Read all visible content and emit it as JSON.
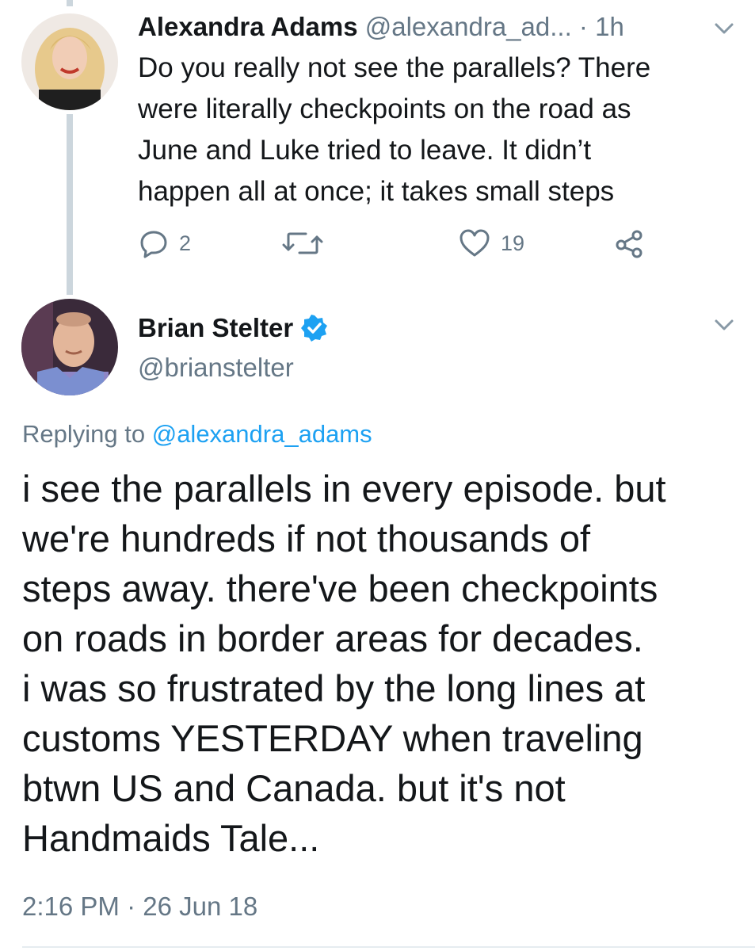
{
  "parent_tweet": {
    "display_name": "Alexandra Adams",
    "handle": "@alexandra_ad...",
    "time": "1h",
    "separator": "·",
    "text": "Do you really not see the parallels? There\nwere literally checkpoints on the road as\nJune and Luke tried to leave. It didn’t\nhappen all at once; it takes small steps",
    "reply_count": "2",
    "retweet_count": "",
    "like_count": "19",
    "icons": [
      "reply-icon",
      "retweet-icon",
      "like-icon",
      "share-icon",
      "chevron-down-icon"
    ]
  },
  "main_tweet": {
    "display_name": "Brian Stelter",
    "handle": "@brianstelter",
    "replying_prefix": "Replying to",
    "replying_handle": "@alexandra_adams",
    "text": "i see the parallels in every episode. but\nwe're hundreds if not thousands of\nsteps away. there've been checkpoints\non roads in border areas for decades.\ni was so frustrated by the long lines at\ncustoms YESTERDAY when traveling\nbtwn US and Canada. but it's not\nHandmaids Tale...",
    "timestamp": "2:16 PM · 26 Jun 18",
    "icons": [
      "verified-badge-icon",
      "chevron-down-icon"
    ]
  },
  "colors": {
    "text": "#14171a",
    "muted": "#657786",
    "link": "#1da1f2",
    "thread_line": "#ccd6dd"
  }
}
